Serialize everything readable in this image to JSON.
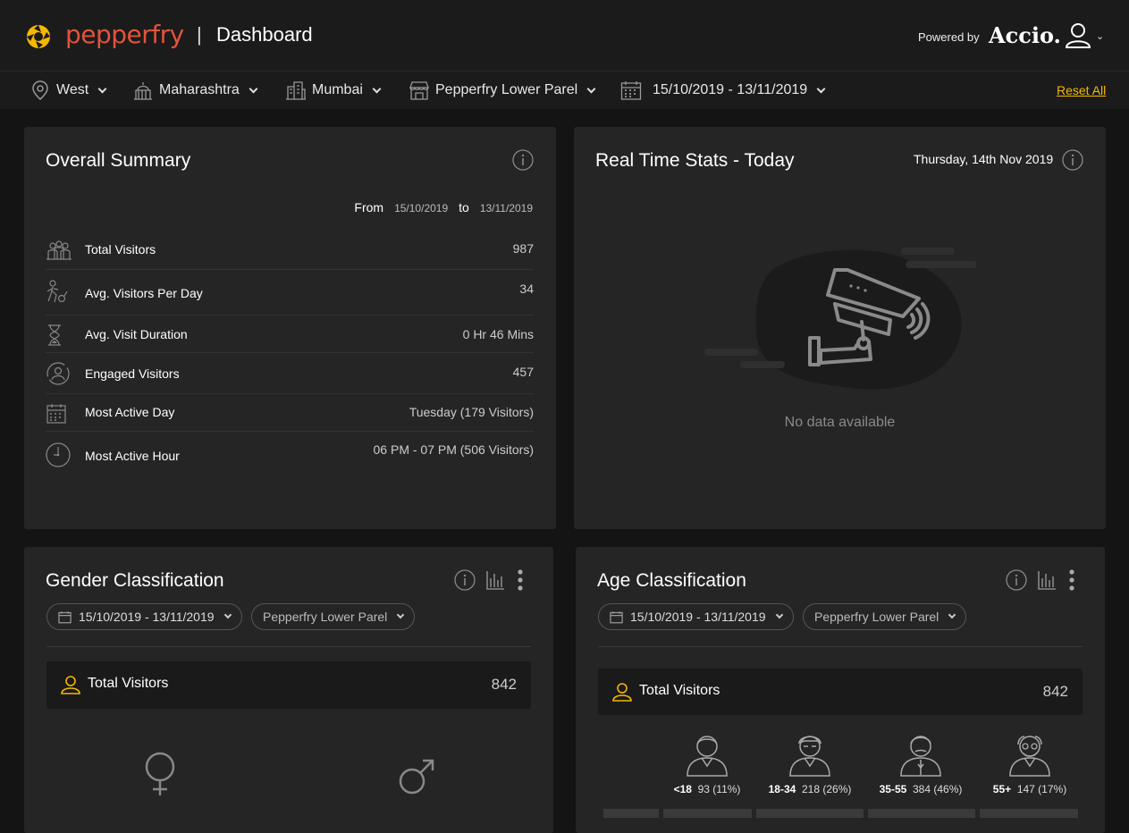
{
  "header": {
    "brand": "pepperfry",
    "separator": "|",
    "title": "Dashboard",
    "powered_by": "Powered by",
    "partner": "Accio.",
    "brand_color": "#e2533c",
    "accent_color": "#f5b800"
  },
  "filters": {
    "region": "West",
    "state": "Maharashtra",
    "city": "Mumbai",
    "store": "Pepperfry Lower Parel",
    "date_range": "15/10/2019 - 13/11/2019",
    "reset": "Reset All"
  },
  "summary": {
    "title": "Overall Summary",
    "from_label": "From",
    "from_date": "15/10/2019",
    "to_label": "to",
    "to_date": "13/11/2019",
    "rows": [
      {
        "label": "Total Visitors",
        "value": "987",
        "icon": "visitors-group-icon"
      },
      {
        "label": "Avg. Visitors Per Day",
        "value": "34",
        "icon": "walking-person-icon"
      },
      {
        "label": "Avg. Visit Duration",
        "value": "0 Hr 46 Mins",
        "icon": "hourglass-icon"
      },
      {
        "label": "Engaged Visitors",
        "value": "457",
        "icon": "engaged-person-icon"
      },
      {
        "label": "Most Active Day",
        "value": "Tuesday (179 Visitors)",
        "icon": "calendar-icon"
      },
      {
        "label": "Most Active Hour",
        "value": "06 PM - 07 PM (506 Visitors)",
        "icon": "clock-icon"
      }
    ]
  },
  "realtime": {
    "title": "Real Time Stats - Today",
    "date": "Thursday, 14th Nov 2019",
    "empty_text": "No data available"
  },
  "gender": {
    "title": "Gender Classification",
    "date_pill": "15/10/2019 - 13/11/2019",
    "store_pill": "Pepperfry Lower Parel",
    "total_label": "Total Visitors",
    "total_value": "842"
  },
  "age": {
    "title": "Age Classification",
    "date_pill": "15/10/2019 - 13/11/2019",
    "store_pill": "Pepperfry Lower Parel",
    "total_label": "Total Visitors",
    "total_value": "842",
    "groups": [
      {
        "range": "<18",
        "stat": "93 (11%)"
      },
      {
        "range": "18-34",
        "stat": "218 (26%)"
      },
      {
        "range": "35-55",
        "stat": "384 (46%)"
      },
      {
        "range": "55+",
        "stat": "147 (17%)"
      }
    ]
  }
}
